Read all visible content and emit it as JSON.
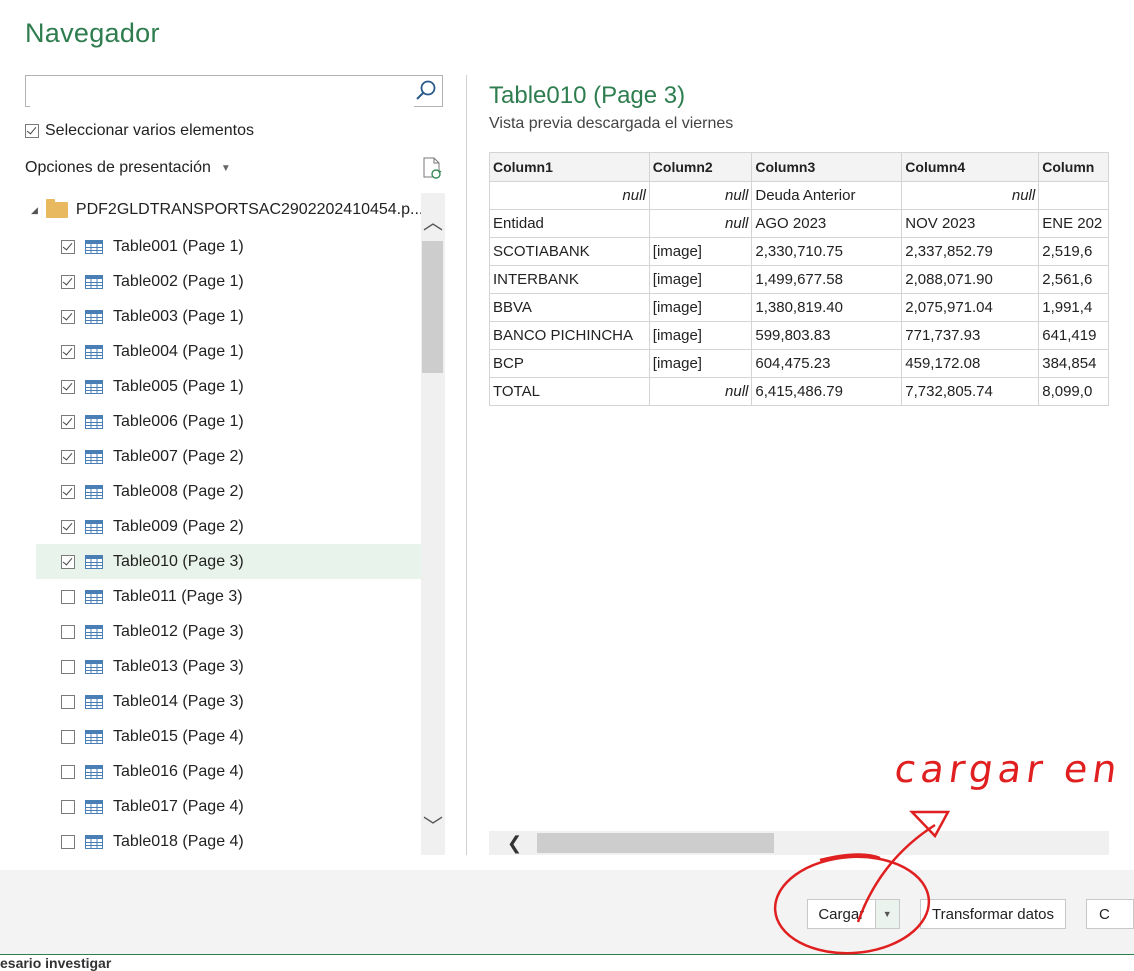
{
  "window": {
    "title": "Navegador"
  },
  "search": {
    "value": "",
    "placeholder": ""
  },
  "multi_select": {
    "label": "Seleccionar varios elementos",
    "checked": true
  },
  "display_options": {
    "label": "Opciones de presentación"
  },
  "tree": {
    "folder": "PDF2GLDTRANSPORTSAC2902202410454.p...",
    "items": [
      {
        "label": "Table001 (Page 1)",
        "checked": true
      },
      {
        "label": "Table002 (Page 1)",
        "checked": true
      },
      {
        "label": "Table003 (Page 1)",
        "checked": true
      },
      {
        "label": "Table004 (Page 1)",
        "checked": true
      },
      {
        "label": "Table005 (Page 1)",
        "checked": true
      },
      {
        "label": "Table006 (Page 1)",
        "checked": true
      },
      {
        "label": "Table007 (Page 2)",
        "checked": true
      },
      {
        "label": "Table008 (Page 2)",
        "checked": true
      },
      {
        "label": "Table009 (Page 2)",
        "checked": true
      },
      {
        "label": "Table010 (Page 3)",
        "checked": true,
        "selected": true
      },
      {
        "label": "Table011 (Page 3)",
        "checked": false
      },
      {
        "label": "Table012 (Page 3)",
        "checked": false
      },
      {
        "label": "Table013 (Page 3)",
        "checked": false
      },
      {
        "label": "Table014 (Page 3)",
        "checked": false
      },
      {
        "label": "Table015 (Page 4)",
        "checked": false
      },
      {
        "label": "Table016 (Page 4)",
        "checked": false
      },
      {
        "label": "Table017 (Page 4)",
        "checked": false
      },
      {
        "label": "Table018 (Page 4)",
        "checked": false
      }
    ]
  },
  "preview": {
    "title": "Table010 (Page 3)",
    "subtitle": "Vista previa descargada el viernes",
    "columns": [
      "Column1",
      "Column2",
      "Column3",
      "Column4",
      "Column"
    ],
    "rows": [
      [
        "null",
        "null",
        "Deuda Anterior",
        "null",
        ""
      ],
      [
        "Entidad",
        "null",
        "AGO 2023",
        "NOV 2023",
        "ENE 202"
      ],
      [
        "SCOTIABANK",
        "[image]",
        "2,330,710.75",
        "2,337,852.79",
        "2,519,6"
      ],
      [
        "INTERBANK",
        "[image]",
        "1,499,677.58",
        "2,088,071.90",
        "2,561,6"
      ],
      [
        "BBVA",
        "[image]",
        "1,380,819.40",
        "2,075,971.04",
        "1,991,4"
      ],
      [
        "BANCO PICHINCHA",
        "[image]",
        "599,803.83",
        "771,737.93",
        "641,419"
      ],
      [
        "BCP",
        "[image]",
        "604,475.23",
        "459,172.08",
        "384,854"
      ],
      [
        "TOTAL",
        "null",
        "6,415,486.79",
        "7,732,805.74",
        "8,099,0"
      ]
    ]
  },
  "buttons": {
    "load": "Cargar",
    "transform": "Transformar datos",
    "cancel": "C"
  },
  "status_bar": {
    "text": "esario investigar"
  },
  "annotation": {
    "text": "cargar en",
    "color": "#e02020"
  },
  "colors": {
    "accent": "#2e7d4f",
    "selected_row": "#e8f3ec"
  }
}
